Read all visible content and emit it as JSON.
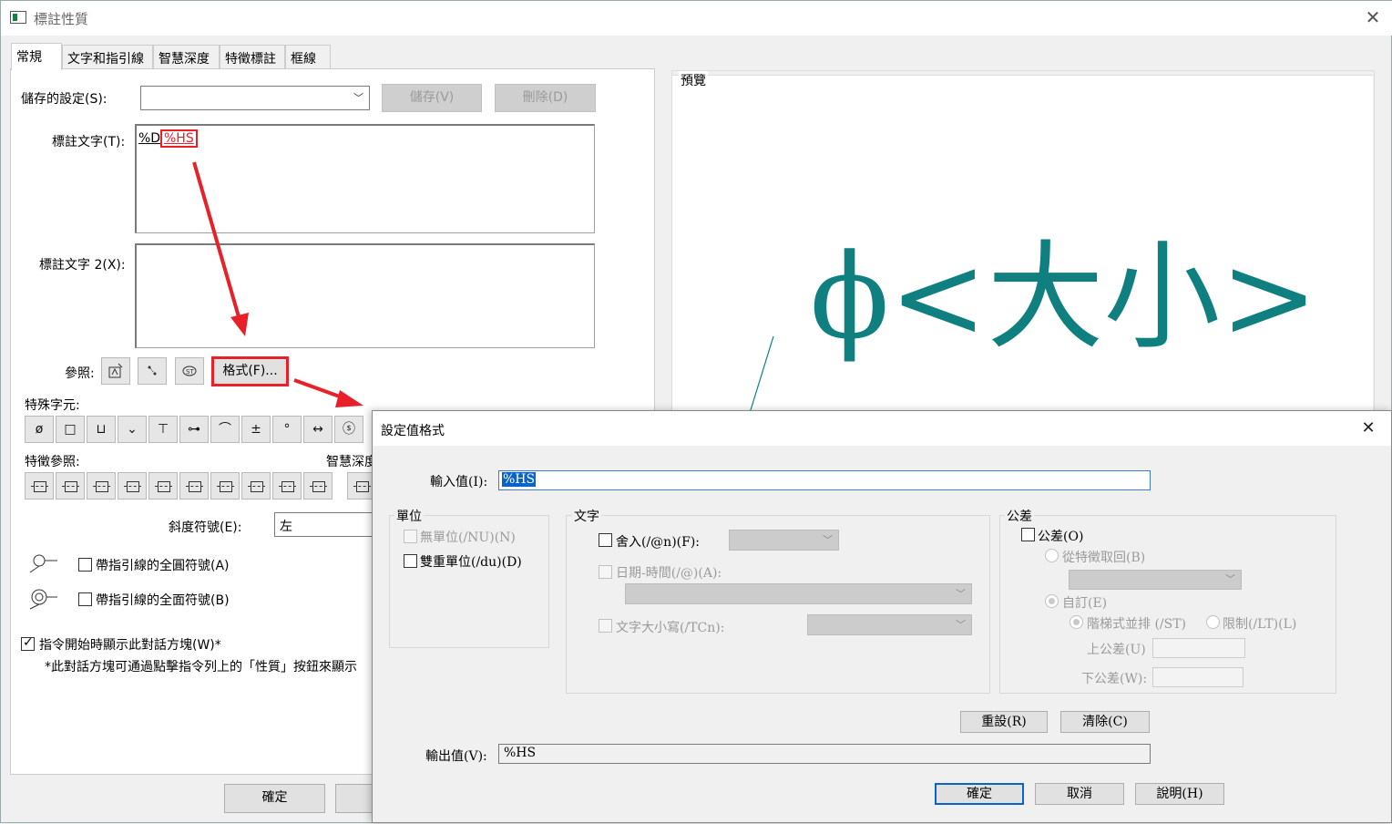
{
  "window": {
    "title": "標註性質",
    "close_label": "✕"
  },
  "tabs": [
    "常規",
    "文字和指引線",
    "智慧深度",
    "特徵標註",
    "框線"
  ],
  "saved_settings": {
    "label": "儲存的設定(S):",
    "value": "",
    "save_button": "儲存(V)",
    "delete_button": "刪除(D)"
  },
  "callout_text": {
    "label": "標註文字(T):",
    "part1": "%D",
    "part2": "%HS"
  },
  "callout_text2": {
    "label": "標註文字 2(X):"
  },
  "reference": {
    "label": "參照:",
    "format_button": "格式(F)..."
  },
  "special_chars": {
    "label": "特殊字元:",
    "symbols": [
      "ø",
      "□",
      "⊔",
      "⌄",
      "⊤",
      "⊶",
      "⌒",
      "±",
      "°",
      "↔",
      "ⓢ"
    ]
  },
  "feature_ref": {
    "label": "特徵參照:",
    "smart_depth_label": "智慧深度"
  },
  "slope": {
    "label": "斜度符號(E):",
    "value": "左"
  },
  "leader_options": {
    "full_circle": "帶指引線的全圓符號(A)",
    "full_surface": "帶指引線的全面符號(B)"
  },
  "show_dialog": {
    "label": "指令開始時顯示此對話方塊(W)*",
    "note": "*此對話方塊可通過點擊指令列上的「性質」按鈕來顯示"
  },
  "main_ok_button": "確定",
  "preview": {
    "label": "預覽",
    "text": "ϕ<大小>",
    "color": "#0f7f7f"
  },
  "annotation_color": "#e8202a",
  "dialog": {
    "title": "設定值格式",
    "close_label": "✕",
    "input_label": "輸入值(I):",
    "input_value": "%HS",
    "units": {
      "title": "單位",
      "no_units": "無單位(/NU)(N)",
      "dual_units": "雙重單位(/du)(D)"
    },
    "text": {
      "title": "文字",
      "round": "舍入(/@n)(F):",
      "datetime": "日期-時間(/@)(A):",
      "case": "文字大小寫(/TCn):"
    },
    "tolerance": {
      "title": "公差",
      "tolerance_check": "公差(O)",
      "from_feature": "從特徵取回(B)",
      "custom": "自訂(E)",
      "stacked": "階梯式並排 (/ST)",
      "limit": "限制(/LT)(L)",
      "upper": "上公差(U)",
      "lower": "下公差(W):"
    },
    "reset_button": "重設(R)",
    "clear_button": "清除(C)",
    "output_label": "輸出值(V):",
    "output_value": "%HS",
    "ok_button": "確定",
    "cancel_button": "取消",
    "help_button": "說明(H)"
  }
}
